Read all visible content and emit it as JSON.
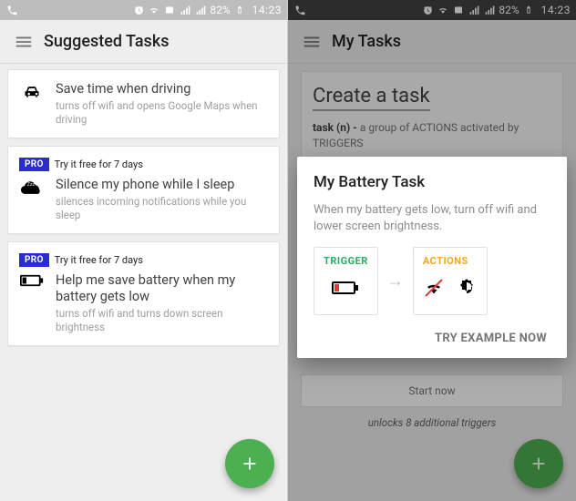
{
  "statusbar": {
    "battery_pct": "82%",
    "clock": "14:23"
  },
  "screen1": {
    "title": "Suggested Tasks",
    "cards": [
      {
        "title": "Save time when driving",
        "sub": "turns off wifi and opens Google Maps when driving",
        "icon": "car"
      },
      {
        "pro": true,
        "trial": "Try it free for 7 days",
        "title": "Silence my phone while I sleep",
        "sub": "silences incoming notifications while you sleep",
        "icon": "cloud-zzz",
        "badge": "PRO"
      },
      {
        "pro": true,
        "trial": "Try it free for 7 days",
        "title": "Help me save battery when my battery gets low",
        "sub": "turns off wifi and turns down screen brightness",
        "icon": "battery-low",
        "badge": "PRO"
      }
    ]
  },
  "screen2": {
    "title": "My Tasks",
    "create_title": "Create a task",
    "definition_bold": "task (n) -",
    "definition_rest": "a group of ACTIONS activated by TRIGGERS",
    "start_now": "Start now",
    "unlock_line": "unlocks 8 additional triggers",
    "dialog": {
      "title": "My Battery Task",
      "desc": "When my battery gets low, turn off wifi and lower screen brightness.",
      "trigger_label": "TRIGGER",
      "actions_label": "ACTIONS",
      "cta": "TRY EXAMPLE NOW"
    }
  }
}
